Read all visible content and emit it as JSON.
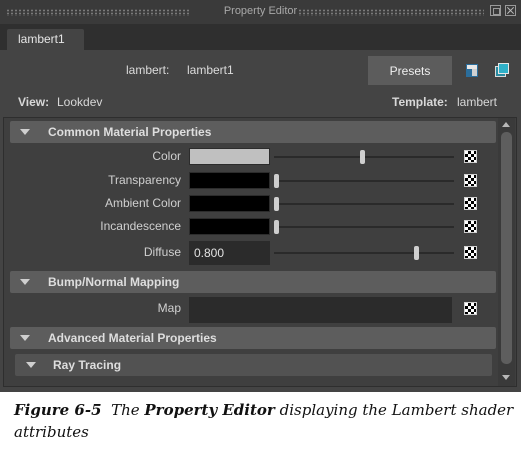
{
  "window": {
    "title": "Property Editor"
  },
  "tab": {
    "label": "lambert1"
  },
  "header": {
    "type_label": "lambert:",
    "node_name": "lambert1",
    "presets_label": "Presets"
  },
  "view": {
    "label": "View:",
    "value": "Lookdev"
  },
  "template": {
    "label": "Template:",
    "value": "lambert"
  },
  "sections": {
    "common": {
      "label": "Common Material Properties"
    },
    "bump": {
      "label": "Bump/Normal Mapping"
    },
    "advanced": {
      "label": "Advanced Material Properties"
    },
    "raytracing": {
      "label": "Ray Tracing"
    }
  },
  "attributes": {
    "color": {
      "label": "Color",
      "swatch": "#c0c0c0",
      "slider": 0.49
    },
    "transparency": {
      "label": "Transparency",
      "swatch": "#000000",
      "slider": 0.0
    },
    "ambient_color": {
      "label": "Ambient Color",
      "swatch": "#000000",
      "slider": 0.0
    },
    "incandescence": {
      "label": "Incandescence",
      "swatch": "#000000",
      "slider": 0.0
    },
    "diffuse": {
      "label": "Diffuse",
      "value": "0.800",
      "slider": 0.8
    },
    "map": {
      "label": "Map"
    }
  },
  "icons": {
    "float": "float-window-icon",
    "close": "close-icon",
    "focus": "focus-icon",
    "copy": "copy-tab-icon",
    "map": "map-checker-icon"
  },
  "caption": {
    "fig": "Figure 6-5",
    "text_pre": "The",
    "bold": "Property Editor",
    "text_post": "displaying the Lambert shader attributes"
  }
}
